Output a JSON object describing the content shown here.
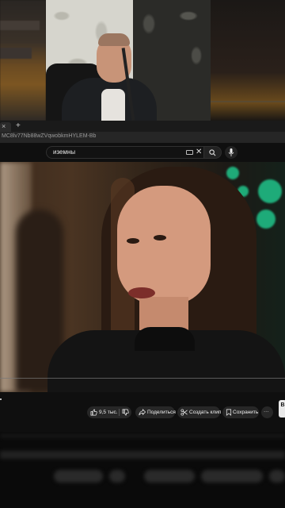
{
  "browser": {
    "url": "MC8lv77Nb88wZVqwobkmHYLEM-Bb",
    "new_tab_symbol": "+",
    "tab_close_symbol": "×"
  },
  "youtube": {
    "search_value": "иземны",
    "clear_symbol": "✕"
  },
  "actions": {
    "like_count": "9,5 тыс.",
    "share_label": "Поделиться",
    "clip_label": "Создать клип",
    "save_label": "Сохранить",
    "more_symbol": "···",
    "edge_letter": "В"
  },
  "colors": {
    "bg": "#0f0f0f",
    "pill": "#272727",
    "bokeh_green": "#20c48a"
  },
  "icons": [
    "keyboard-icon",
    "clear-icon",
    "search-icon",
    "mic-icon",
    "thumb-up-icon",
    "thumb-down-icon",
    "share-icon",
    "scissors-icon",
    "bookmark-icon",
    "more-icon"
  ]
}
